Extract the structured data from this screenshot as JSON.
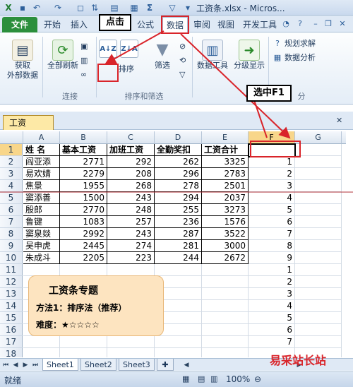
{
  "window": {
    "title": "工资条.xlsx - Micros...",
    "qat_icons": [
      "excel-logo-icon",
      "save-icon",
      "undo-icon",
      "redo-icon",
      "print-preview-icon",
      "sort-icon",
      "border-icon",
      "sum-icon",
      "filter-icon",
      "more-icon"
    ]
  },
  "ribbon_tabs": [
    "文件",
    "开始",
    "插入",
    "公式",
    "数据",
    "审阅",
    "视图",
    "开发工具"
  ],
  "ribbon": {
    "get_external": "获取\n外部数据",
    "refresh_all": "全部刷新",
    "connections_group": "连接",
    "sort": "排序",
    "filter": "筛选",
    "sort_filter_group": "排序和筛选",
    "data_tools": "数据工具",
    "outline": "分级显示",
    "solver": "规划求解",
    "data_analysis": "数据分析",
    "group_last": "分"
  },
  "workbook_tab": "工资条.xlsx",
  "columns": [
    "A",
    "B",
    "C",
    "D",
    "E",
    "F",
    "G"
  ],
  "rows": [
    "1",
    "2",
    "3",
    "4",
    "5",
    "6",
    "7",
    "8",
    "9",
    "10",
    "11",
    "12",
    "13",
    "14",
    "15",
    "16",
    "17",
    "18"
  ],
  "table": {
    "headers": [
      "姓 名",
      "基本工资",
      "加班工资",
      "全勤奖扣",
      "工资合计"
    ],
    "records": [
      [
        "阎亚添",
        "2771",
        "292",
        "262",
        "3325"
      ],
      [
        "易欢婧",
        "2279",
        "208",
        "296",
        "2783"
      ],
      [
        "焦景",
        "1955",
        "268",
        "278",
        "2501"
      ],
      [
        "窦添善",
        "1500",
        "243",
        "294",
        "2037"
      ],
      [
        "殷郎",
        "2770",
        "248",
        "255",
        "3273"
      ],
      [
        "鲁键",
        "1083",
        "257",
        "236",
        "1576"
      ],
      [
        "窦泉燚",
        "2992",
        "243",
        "287",
        "3522"
      ],
      [
        "吴申虎",
        "2445",
        "274",
        "281",
        "3000"
      ],
      [
        "朱成斗",
        "2205",
        "223",
        "244",
        "2672"
      ]
    ]
  },
  "column_f": [
    "",
    "1",
    "2",
    "3",
    "4",
    "5",
    "6",
    "7",
    "8",
    "9",
    "1",
    "2",
    "3",
    "4",
    "5",
    "6",
    "7"
  ],
  "card": {
    "title": "工资条专题",
    "method": "方法1：排序法（推荐）",
    "difficulty": "难度：★☆☆☆☆"
  },
  "sheets": [
    "Sheet1",
    "Sheet2",
    "Sheet3"
  ],
  "status": {
    "mode": "就绪",
    "zoom": "100%"
  },
  "annotations": {
    "click": "点击",
    "select_f1": "选中F1"
  },
  "watermark": "易采站长站",
  "colors": {
    "file_tab": "#2b8f3c",
    "annotation_red": "#d9242a",
    "card_bg": "#fde4c0"
  }
}
